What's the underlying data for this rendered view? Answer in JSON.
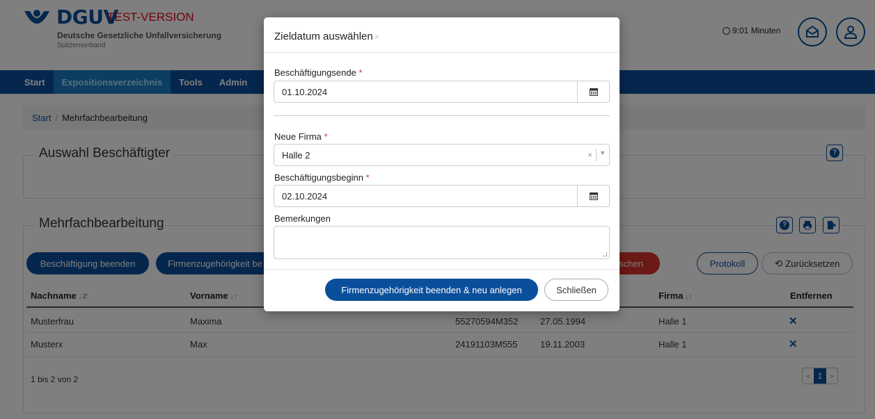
{
  "header": {
    "brand": "DGUV",
    "test_label": "TEST-VERSION",
    "subtitle": "Deutsche Gesetzliche Unfallversicherung",
    "subtitle2": "Spitzenverband",
    "timer": "9:01 Minuten",
    "brand_color": "#0b4f9c"
  },
  "nav": {
    "items": [
      "Start",
      "Expositionsverzeichnis",
      "Tools",
      "Admin"
    ]
  },
  "breadcrumb": {
    "root": "Start",
    "separator": "/",
    "current": "Mehrfachbearbeitung"
  },
  "panel_auswahl": {
    "title": "Auswahl Beschäftigter",
    "help": "?"
  },
  "panel_mehrfach": {
    "title": "Mehrfachbearbeitung",
    "help": "?",
    "buttons": {
      "end_employment": "Beschäftigung beenden",
      "end_company": "Firmenzugehörigkeit be",
      "delete": "schen",
      "protocol": "Protokoll",
      "reset": "Zurücksetzen"
    },
    "columns": {
      "nachname": "Nachname",
      "vorname": "Vorname",
      "firma": "Firma",
      "entfernen": "Entfernen",
      "sort_asc": "↓⇵",
      "sort": "↓↑"
    },
    "rows": [
      {
        "nachname": "Musterfrau",
        "vorname": "Maxima",
        "id": "55270594M352",
        "date": "27.05.1994",
        "firma": "Halle 1",
        "remove": "✕"
      },
      {
        "nachname": "Musterx",
        "vorname": "Max",
        "id": "24191103M555",
        "date": "19.11.2003",
        "firma": "Halle 1",
        "remove": "✕"
      }
    ],
    "summary": "1 bis 2 von 2",
    "pager": {
      "prev": "‹",
      "current": "1",
      "next": "›"
    }
  },
  "modal": {
    "title": "Zieldatum auswählen",
    "close": "×",
    "required_mark": "*",
    "field_end": {
      "label": "Beschäftigungsende",
      "value": "01.10.2024"
    },
    "field_company": {
      "label": "Neue Firma",
      "value": "Halle 2",
      "clear": "×",
      "caret": "▼"
    },
    "field_start": {
      "label": "Beschäftigungsbeginn",
      "value": "02.10.2024"
    },
    "field_notes": {
      "label": "Bemerkungen",
      "value": ""
    },
    "primary_button": "Firmenzugehörigkeit beenden & neu anlegen",
    "close_button": "Schließen"
  }
}
